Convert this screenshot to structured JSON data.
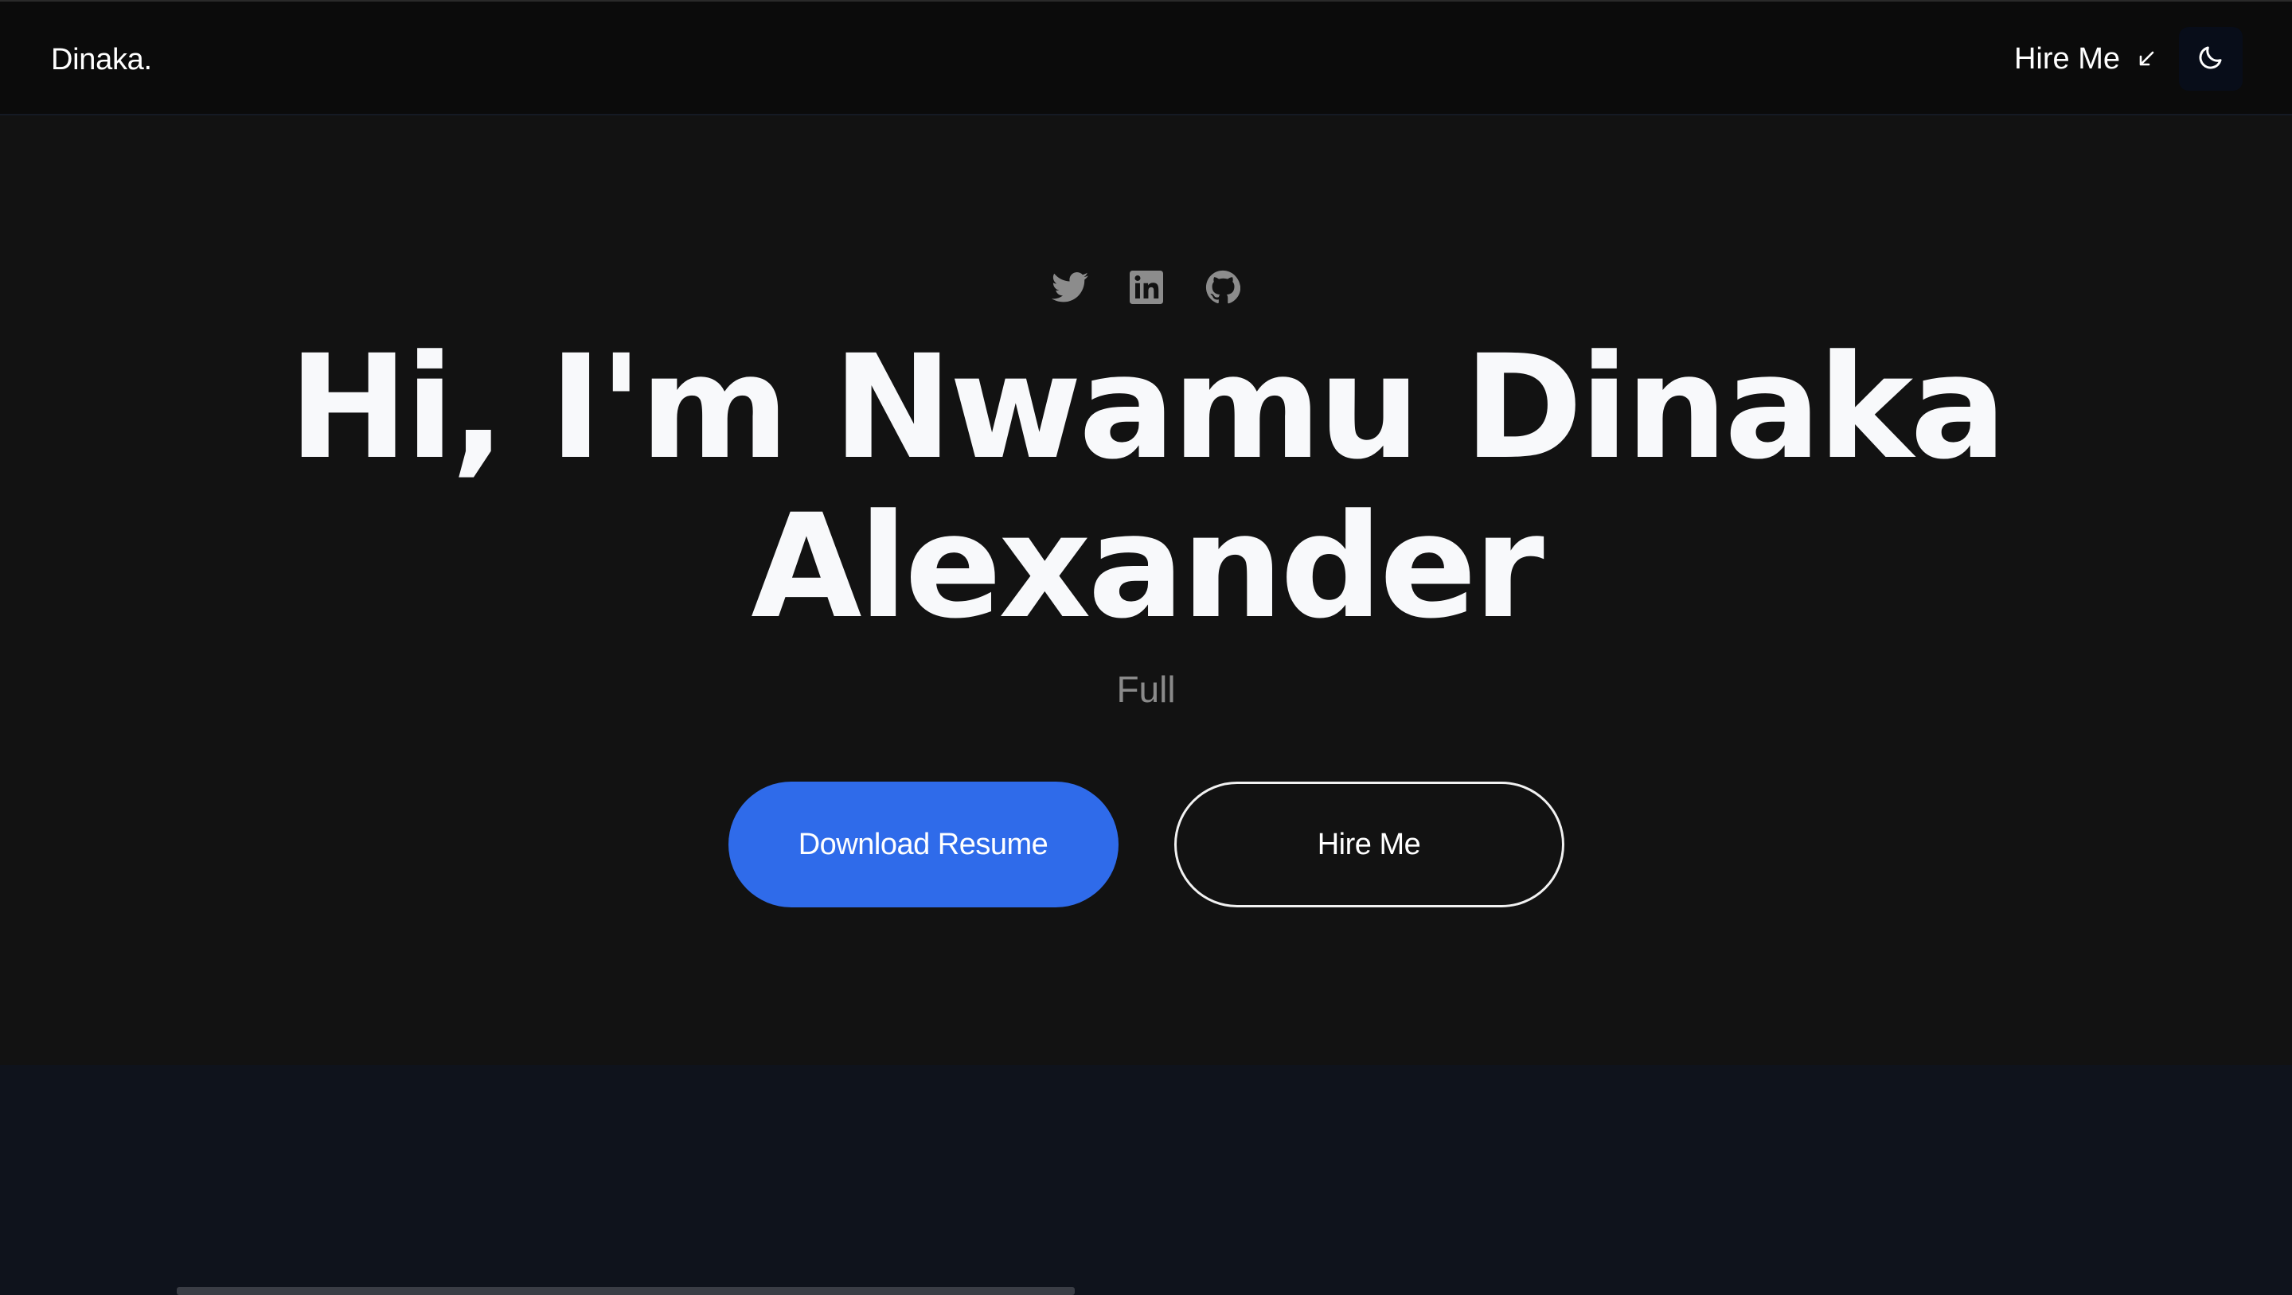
{
  "navbar": {
    "brand": "Dinaka.",
    "hire_label": "Hire Me",
    "hire_icon": "arrow-down-left-icon",
    "theme_icon": "moon-icon"
  },
  "hero": {
    "socials": [
      {
        "name": "twitter",
        "icon": "twitter-icon"
      },
      {
        "name": "linkedin",
        "icon": "linkedin-icon"
      },
      {
        "name": "github",
        "icon": "github-icon"
      }
    ],
    "headline_line1": "Hi, I'm Nwamu Dinaka",
    "headline_line2": "Alexander",
    "tagline": "Full",
    "primary_button": "Download Resume",
    "secondary_button": "Hire Me"
  },
  "colors": {
    "accent": "#2f6bea",
    "hero_bg": "#121212",
    "nav_bg": "#0b0b0b",
    "section_bg": "#0f131c",
    "text": "#f8f9fb",
    "muted": "#8a8a8a"
  }
}
